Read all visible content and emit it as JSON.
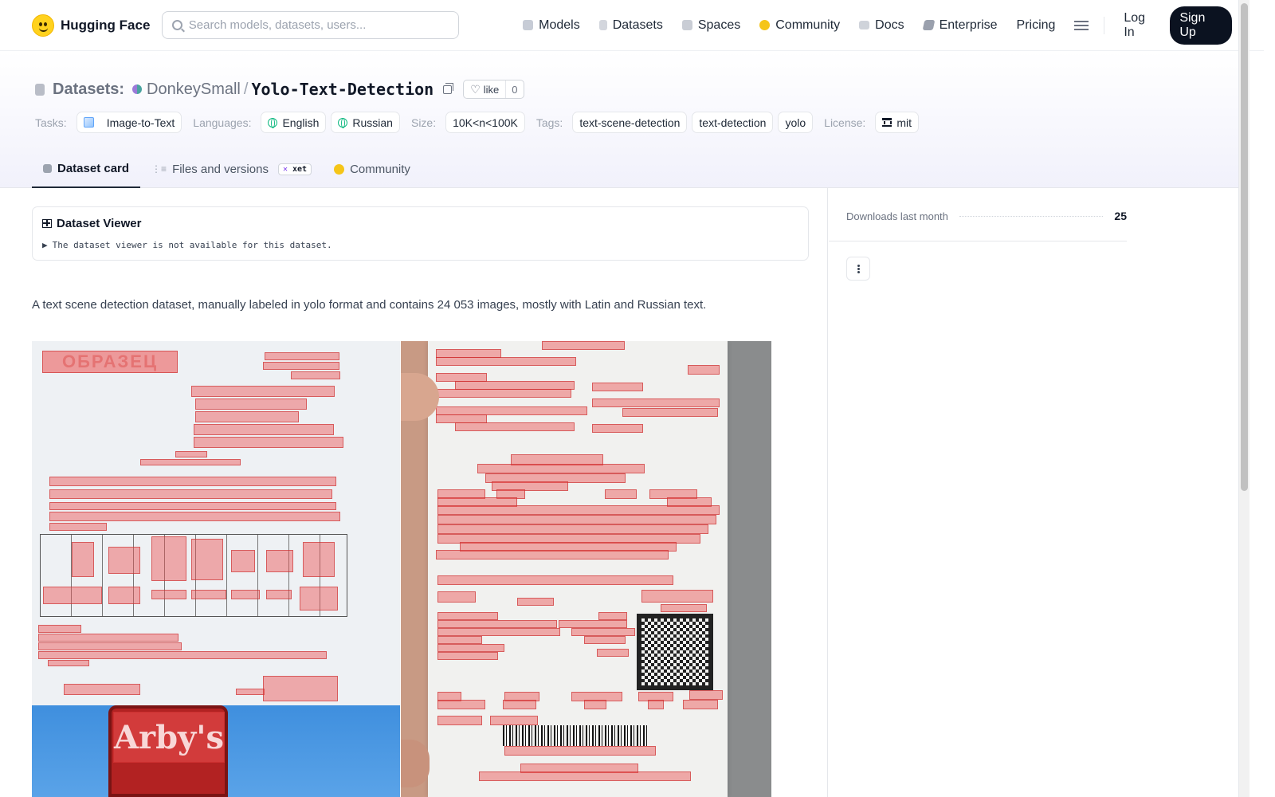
{
  "nav": {
    "brand": "Hugging Face",
    "search_placeholder": "Search models, datasets, users...",
    "links": [
      {
        "label": "Models",
        "icon": "cube-icon"
      },
      {
        "label": "Datasets",
        "icon": "database-icon"
      },
      {
        "label": "Spaces",
        "icon": "grid-icon"
      },
      {
        "label": "Community",
        "icon": "hug-icon"
      },
      {
        "label": "Docs",
        "icon": "book-icon"
      },
      {
        "label": "Enterprise",
        "icon": "building-icon"
      },
      {
        "label": "Pricing"
      }
    ],
    "login": "Log In",
    "signup": "Sign Up"
  },
  "repo": {
    "type_label": "Datasets:",
    "owner": "DonkeySmall",
    "separator": "/",
    "name": "Yolo-Text-Detection",
    "like_label": "like",
    "like_count": "0"
  },
  "tags": {
    "tasks_label": "Tasks:",
    "tasks": [
      "Image-to-Text"
    ],
    "languages_label": "Languages:",
    "languages": [
      "English",
      "Russian"
    ],
    "size_label": "Size:",
    "size": "10K<n<100K",
    "tags_label": "Tags:",
    "tags": [
      "text-scene-detection",
      "text-detection",
      "yolo"
    ],
    "license_label": "License:",
    "license": "mit"
  },
  "tabs": {
    "card": "Dataset card",
    "files": "Files and versions",
    "xet": "xet",
    "community": "Community"
  },
  "viewer": {
    "title": "Dataset Viewer",
    "note_arrow": "▶",
    "note": "The dataset viewer is not available for this dataset."
  },
  "description": "A text scene detection dataset, manually labeled in yolo format and contains 24 053 images, mostly with Latin and Russian text.",
  "images": {
    "doc_stamp": "ОБРАЗЕЦ",
    "sign_text": "Arby's"
  },
  "sidebar": {
    "downloads_label": "Downloads last month",
    "downloads_value": "25"
  },
  "colors": {
    "accent_dark": "#0b1220",
    "highlight": "#ec5050",
    "brand_yellow": "#ffd21e"
  }
}
